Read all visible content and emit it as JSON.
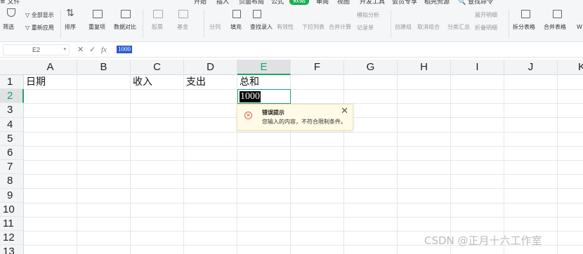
{
  "tabs": {
    "items": [
      "开始",
      "插入",
      "页面布局",
      "公式",
      "数据",
      "审阅",
      "视图",
      "开发工具",
      "会员专享",
      "稻壳资源"
    ],
    "active": "数据",
    "search": "查找命令"
  },
  "ribbon": {
    "filter": "筛选",
    "show_all": "全部显示",
    "reapply": "重新应用",
    "sort": "排序",
    "duplicates": "重复项",
    "compare": "数据对比",
    "stock": "股票",
    "fund": "基金",
    "split_col": "分列",
    "fill": "填充",
    "lookup": "查找录入",
    "validity": "有效性",
    "dropdown": "下拉列表",
    "consolidate": "合并计算",
    "what_if": "模拟分析",
    "record": "记录单",
    "create_group": "创建组",
    "ungroup": "取消组合",
    "subtotal": "分类汇总",
    "expand_detail": "展开明细",
    "collapse_detail": "折叠明细",
    "split_table": "拆分表格",
    "merge_table": "合并表格",
    "more": "W"
  },
  "formula_bar": {
    "cell_ref": "E2",
    "value": "1000",
    "fx": "fx"
  },
  "columns": [
    "A",
    "B",
    "C",
    "D",
    "E",
    "F",
    "G",
    "H",
    "I",
    "J",
    "K"
  ],
  "rows": [
    "1",
    "2",
    "3",
    "4",
    "5",
    "6",
    "7",
    "8",
    "9",
    "10",
    "11",
    "12",
    "13"
  ],
  "cells": {
    "A1": "日期",
    "C1": "收入",
    "D1": "支出",
    "E1": "总和",
    "E2": "1000"
  },
  "error_popup": {
    "title": "错误提示",
    "message": "您输入的内容，不符合限制条件。"
  },
  "watermark": "CSDN @正月十六工作室",
  "colors": {
    "accent": "#1aad55",
    "selection": "#21a366",
    "error": "#e75a5a"
  }
}
